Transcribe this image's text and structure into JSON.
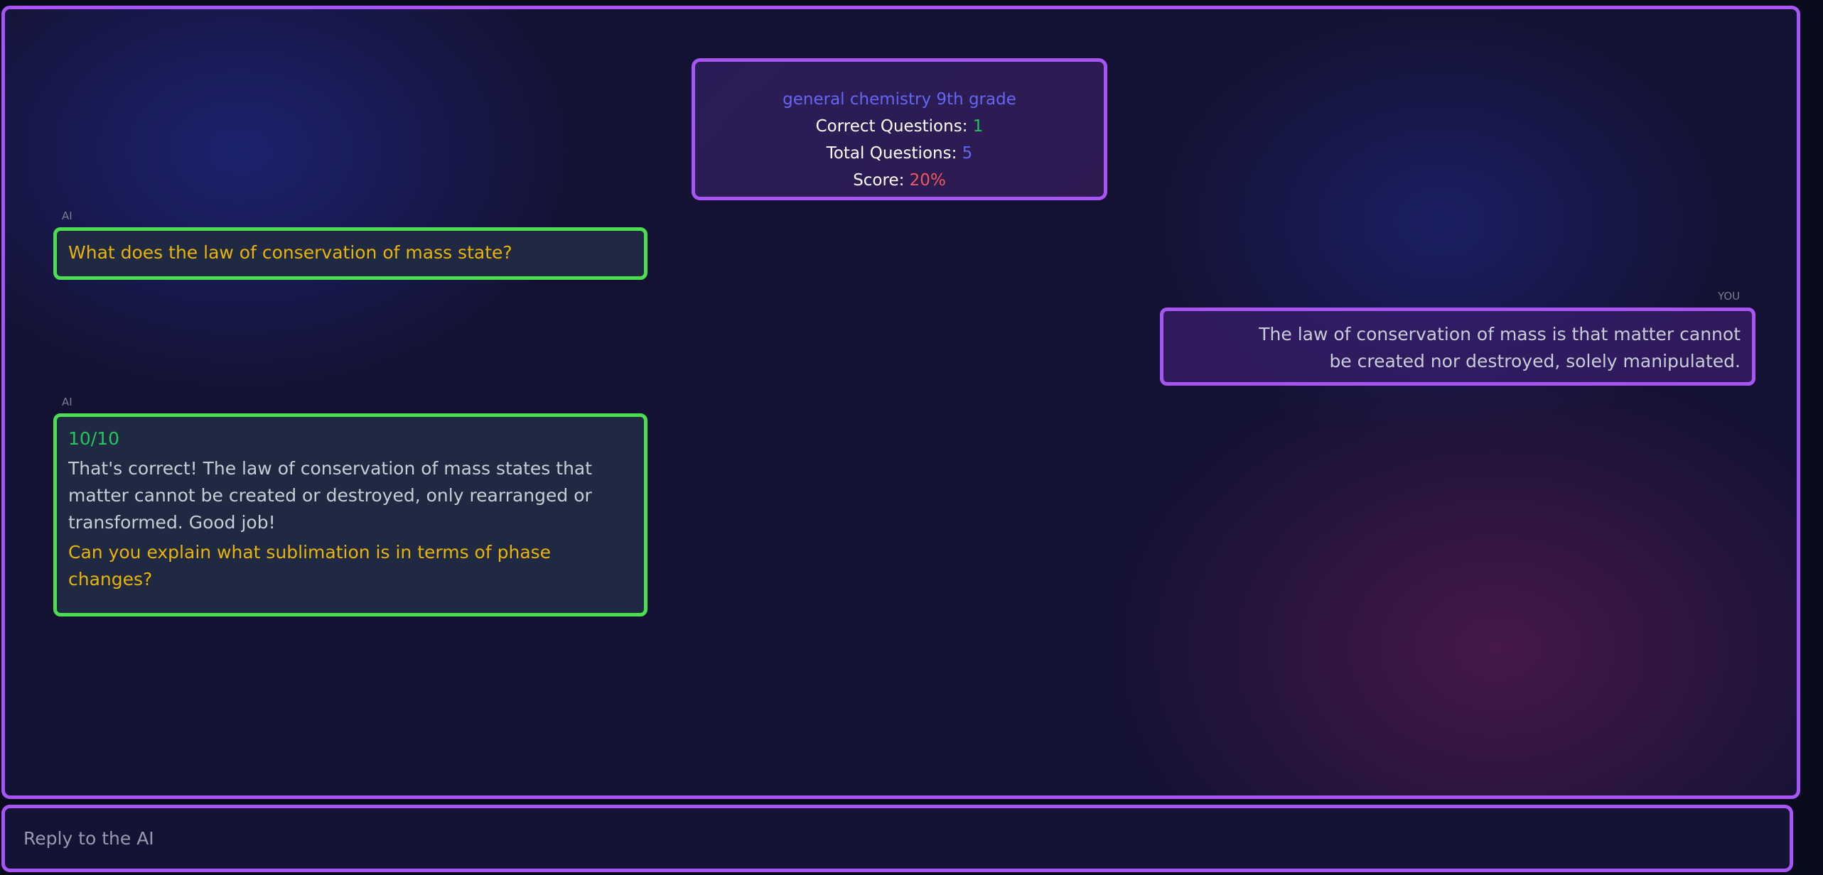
{
  "summary": {
    "topic": "general chemistry 9th grade",
    "correct_label": "Correct Questions: ",
    "correct_value": "1",
    "total_label": "Total Questions: ",
    "total_value": "5",
    "score_label": "Score: ",
    "score_value": "20%"
  },
  "messages": [
    {
      "sender": "AI",
      "question": "What does the law of conservation of mass state?"
    },
    {
      "sender": "YOU",
      "text": "The law of conservation of mass is that matter cannot be created nor destroyed, solely manipulated."
    },
    {
      "sender": "AI",
      "grade": "10/10",
      "feedback": "That's correct! The law of conservation of mass states that matter cannot be created or destroyed, only rearranged or transformed. Good job!",
      "question": "Can you explain what sublimation is in terms of phase changes?"
    }
  ],
  "input": {
    "placeholder": "Reply to the AI",
    "value": ""
  }
}
